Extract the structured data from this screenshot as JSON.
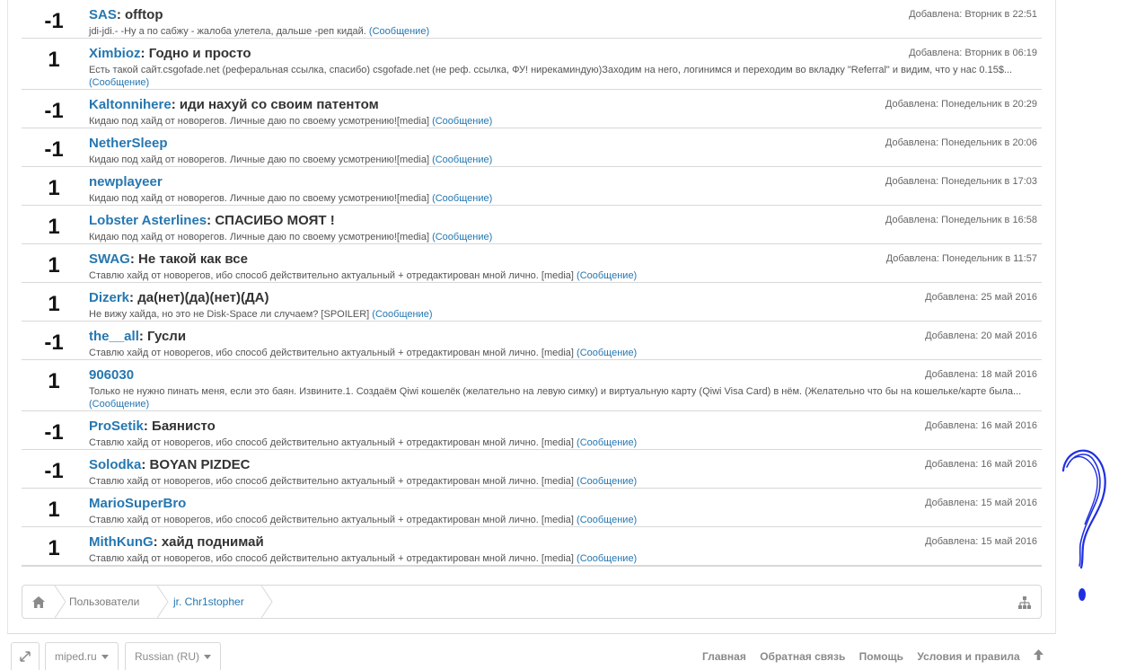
{
  "reputation": [
    {
      "score": "-1",
      "user": "SAS",
      "title": "offtop",
      "text": "jdi-jdi.- -Ну а по сабжу - жалоба улетела, дальше -реп кидай.",
      "link": "(Сообщение)",
      "date": "Добавлена: Вторник в 22:51"
    },
    {
      "score": "1",
      "user": "Ximbioz",
      "title": "Годно и просто",
      "text": "Есть такой сайт.csgofade.net (реферальная ссылка, спасибо) csgofade.net (не реф. ссылка, ФУ! нирекаминдую)Заходим на него, логинимся и переходим во вкладку \"Referral\" и видим, что у нас 0.15$...",
      "link": "(Сообщение)",
      "date": "Добавлена: Вторник в 06:19"
    },
    {
      "score": "-1",
      "user": "Kaltonnihere",
      "title": "иди нахуй со своим патентом",
      "text": "Кидаю под хайд от новорегов. Личные даю по своему усмотрению![media]",
      "link": "(Сообщение)",
      "date": "Добавлена: Понедельник в 20:29"
    },
    {
      "score": "-1",
      "user": "NetherSleep",
      "title": "",
      "text": "Кидаю под хайд от новорегов. Личные даю по своему усмотрению![media]",
      "link": "(Сообщение)",
      "date": "Добавлена: Понедельник в 20:06"
    },
    {
      "score": "1",
      "user": "newplayeer",
      "title": "",
      "text": "Кидаю под хайд от новорегов. Личные даю по своему усмотрению![media]",
      "link": "(Сообщение)",
      "date": "Добавлена: Понедельник в 17:03"
    },
    {
      "score": "1",
      "user": "Lobster Asterlines",
      "title": "СПАСИБО МОЯТ !",
      "text": "Кидаю под хайд от новорегов. Личные даю по своему усмотрению![media]",
      "link": "(Сообщение)",
      "date": "Добавлена: Понедельник в 16:58"
    },
    {
      "score": "1",
      "user": "SWAG",
      "title": "Не такой как все",
      "text": "Ставлю хайд от новорегов, ибо способ действительно актуальный + отредактирован мной лично. [media]",
      "link": "(Сообщение)",
      "date": "Добавлена: Понедельник в 11:57"
    },
    {
      "score": "1",
      "user": "Dizerk",
      "title": "да(нет)(да)(нет)(ДА)",
      "text": "Не вижу хайда, но это не Disk-Space ли случаем? [SPOILER]",
      "link": "(Сообщение)",
      "date": "Добавлена: 25 май 2016"
    },
    {
      "score": "-1",
      "user": "the__all",
      "title": "Гусли",
      "text": "Ставлю хайд от новорегов, ибо способ действительно актуальный + отредактирован мной лично. [media]",
      "link": "(Сообщение)",
      "date": "Добавлена: 20 май 2016"
    },
    {
      "score": "1",
      "user": "906030",
      "title": "",
      "text": "Только не нужно пинать меня, если это баян. Извините.1. Создаём Qiwi кошелёк (желательно на левую симку) и виртуальную карту (Qiwi Visa Card) в нём. (Желательно что бы на кошельке/карте была...",
      "link": "(Сообщение)",
      "date": "Добавлена: 18 май 2016"
    },
    {
      "score": "-1",
      "user": "ProSetik",
      "title": "Баянисто",
      "text": "Ставлю хайд от новорегов, ибо способ действительно актуальный + отредактирован мной лично. [media]",
      "link": "(Сообщение)",
      "date": "Добавлена: 16 май 2016"
    },
    {
      "score": "-1",
      "user": "Solodka",
      "title": "BOYAN PIZDEC",
      "text": "Ставлю хайд от новорегов, ибо способ действительно актуальный + отредактирован мной лично. [media]",
      "link": "(Сообщение)",
      "date": "Добавлена: 16 май 2016"
    },
    {
      "score": "1",
      "user": "MarioSuperBro",
      "title": "",
      "text": "Ставлю хайд от новорегов, ибо способ действительно актуальный + отредактирован мной лично. [media]",
      "link": "(Сообщение)",
      "date": "Добавлена: 15 май 2016"
    },
    {
      "score": "1",
      "user": "MithKunG",
      "title": "хайд поднимай",
      "text": "Ставлю хайд от новорегов, ибо способ действительно актуальный + отредактирован мной лично. [media]",
      "link": "(Сообщение)",
      "date": "Добавлена: 15 май 2016"
    }
  ],
  "breadcrumb": {
    "home_icon": "home-icon",
    "users": "Пользователи",
    "current": "jr. Chr1stopher",
    "sitemap_icon": "sitemap-icon"
  },
  "footer": {
    "fullscreen_icon": "expand-icon",
    "style_label": "miped.ru",
    "language_label": "Russian (RU)",
    "links": [
      "Главная",
      "Обратная связь",
      "Помощь",
      "Условия и правила"
    ],
    "top_icon": "arrow-up-icon"
  },
  "colors": {
    "link": "#2577b1",
    "scribble": "#1f2fe0"
  }
}
